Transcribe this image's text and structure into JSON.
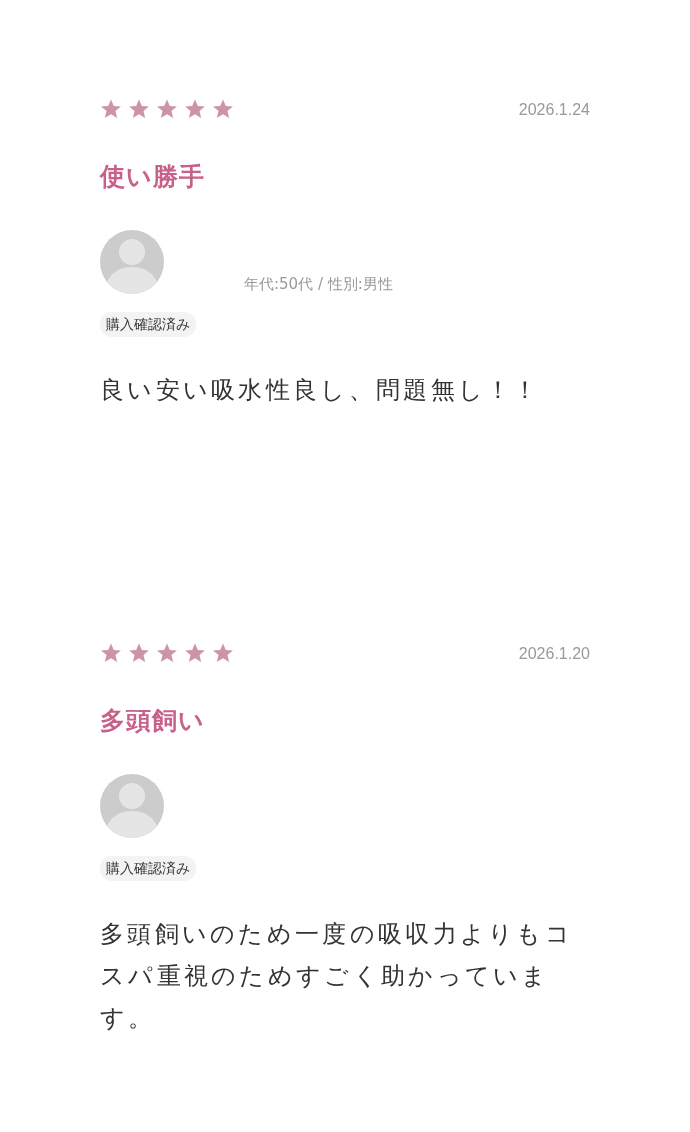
{
  "reviews": [
    {
      "stars": 5,
      "date": "2026.1.24",
      "title": "使い勝手",
      "meta": "年代:50代 / 性別:男性",
      "badge": "購入確認済み",
      "body": "良い安い吸水性良し、問題無し！！"
    },
    {
      "stars": 5,
      "date": "2026.1.20",
      "title": "多頭飼い",
      "badge": "購入確認済み",
      "body": "多頭飼いのため一度の吸収力よりもコスパ重視のためすごく助かっています。"
    }
  ]
}
